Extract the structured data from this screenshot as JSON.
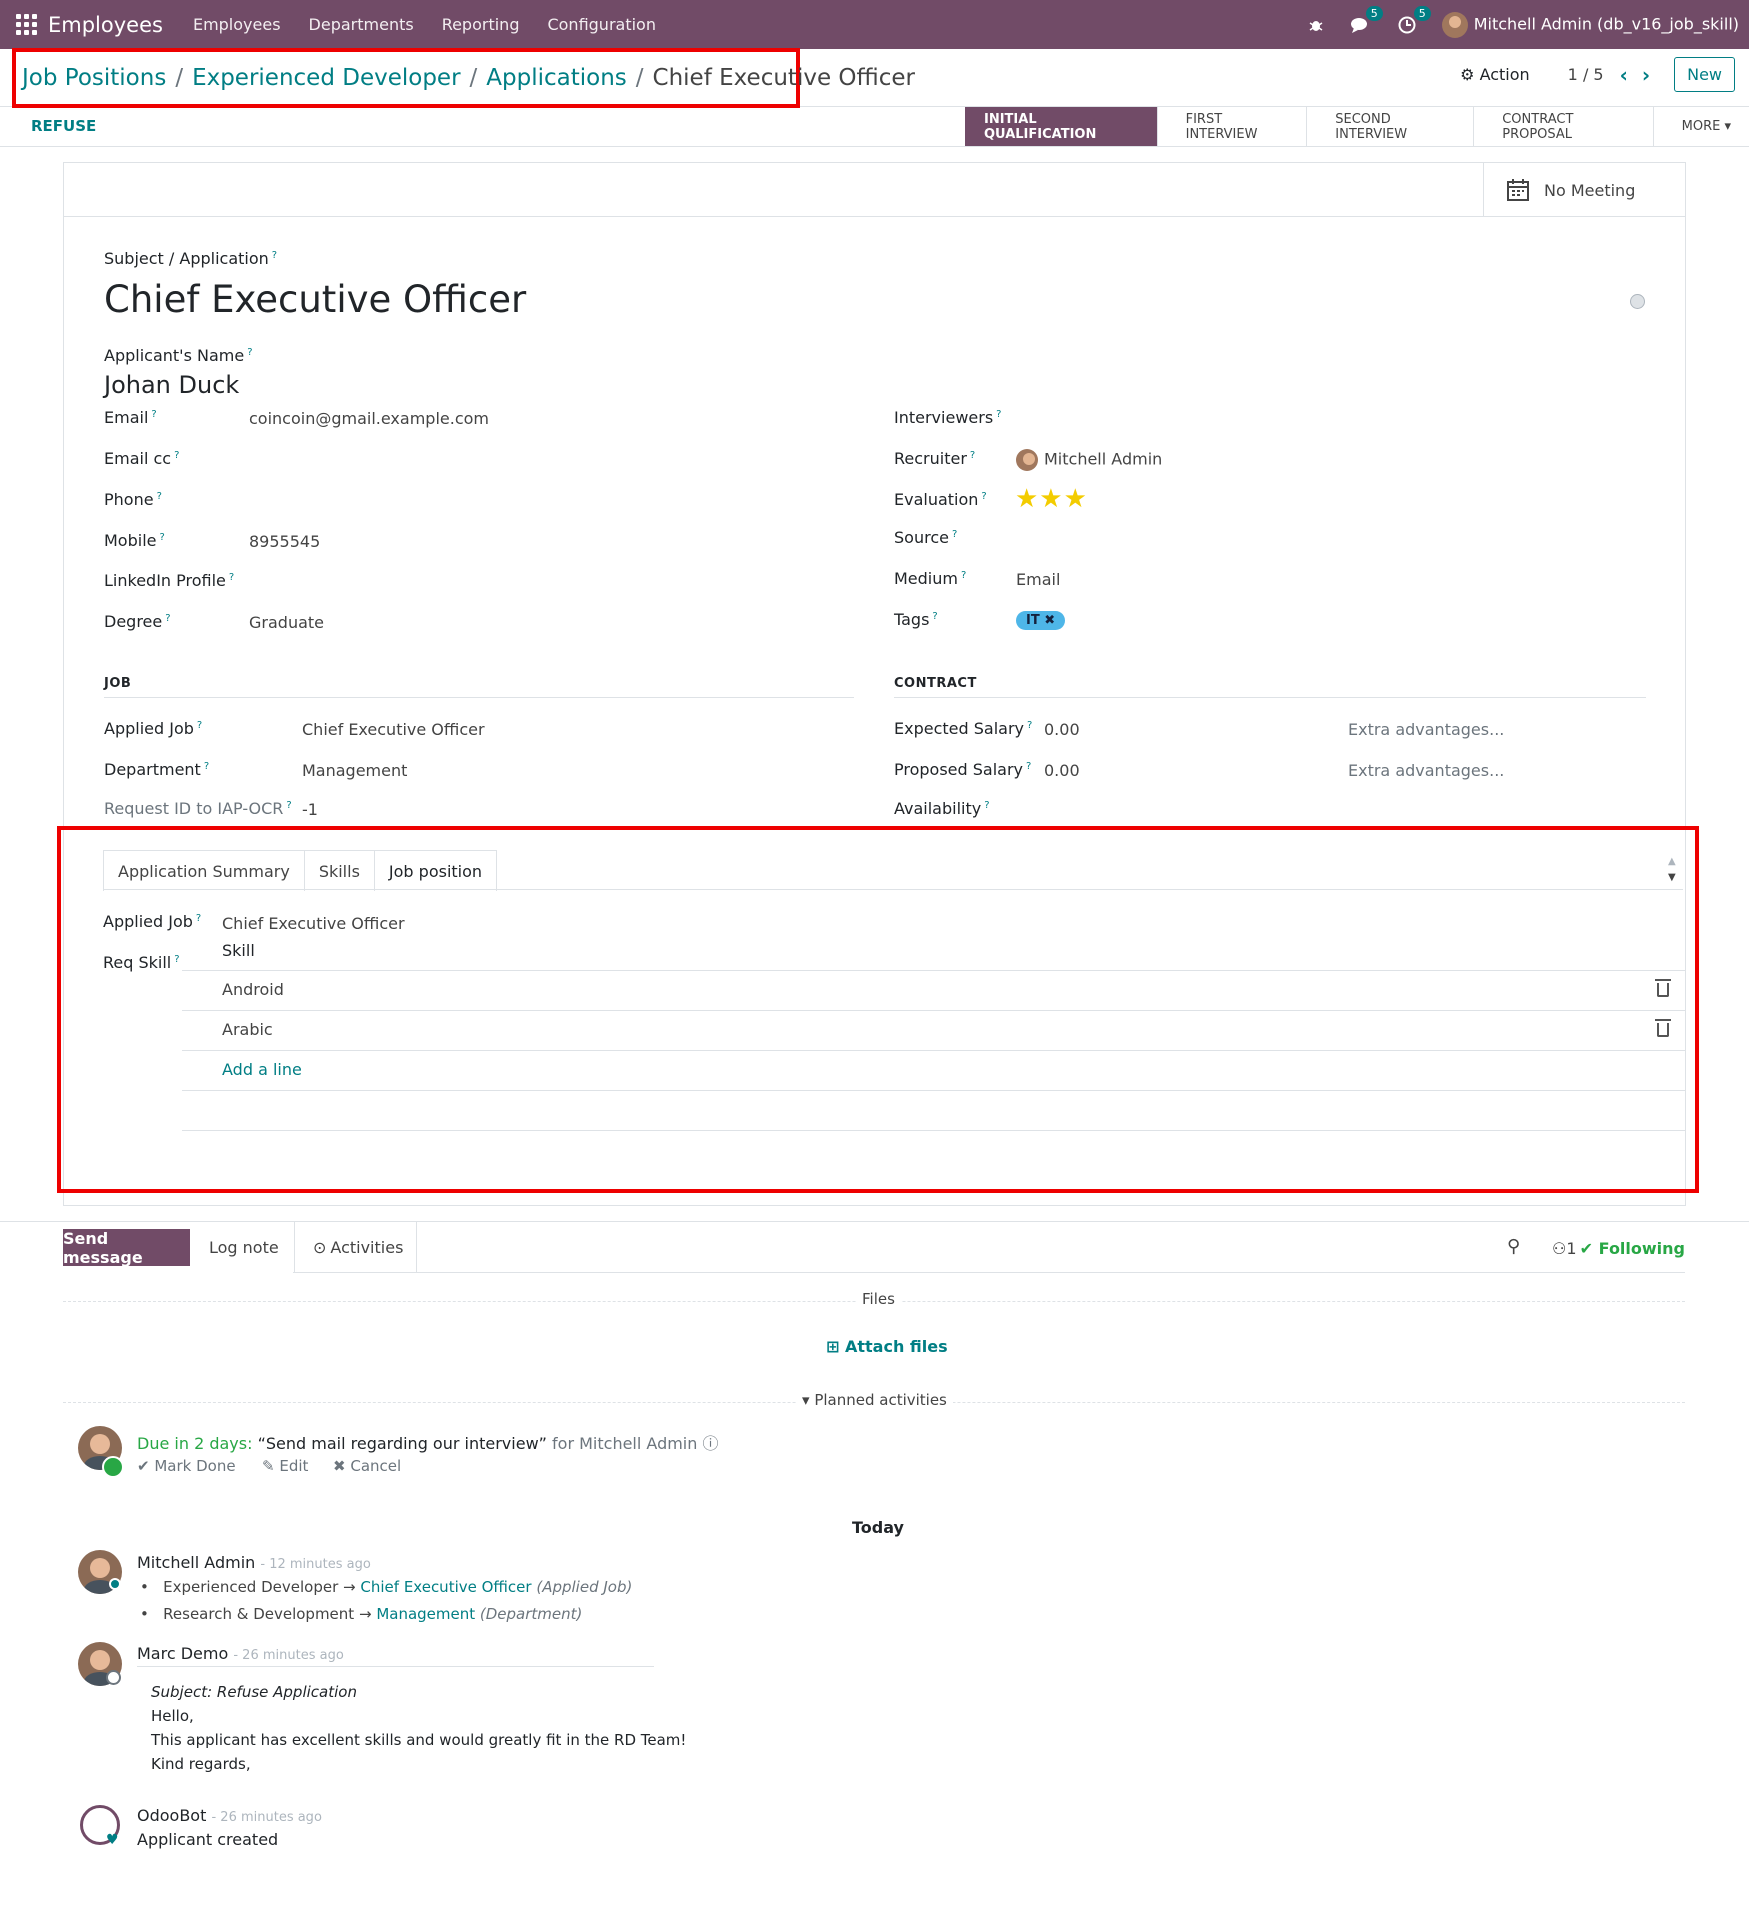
{
  "topbar": {
    "app_name": "Employees",
    "menu": [
      "Employees",
      "Departments",
      "Reporting",
      "Configuration"
    ],
    "chat_count": "5",
    "activity_count": "5",
    "user": "Mitchell Admin (db_v16_job_skill)"
  },
  "breadcrumb": {
    "items": [
      "Job Positions",
      "Experienced Developer",
      "Applications"
    ],
    "current": "Chief Executive Officer"
  },
  "control": {
    "action": "Action",
    "pager": "1 / 5",
    "new": "New"
  },
  "statusbar": {
    "refuse": "REFUSE",
    "stages": [
      "INITIAL QUALIFICATION",
      "FIRST INTERVIEW",
      "SECOND INTERVIEW",
      "CONTRACT PROPOSAL",
      "MORE"
    ]
  },
  "smart_button": "No Meeting",
  "form": {
    "subject_label": "Subject / Application",
    "subject": "Chief Executive Officer",
    "name_label": "Applicant's Name",
    "name": "Johan Duck",
    "left_fields": [
      {
        "label": "Email",
        "value": "coincoin@gmail.example.com"
      },
      {
        "label": "Email cc",
        "value": ""
      },
      {
        "label": "Phone",
        "value": ""
      },
      {
        "label": "Mobile",
        "value": "8955545"
      },
      {
        "label": "LinkedIn Profile",
        "value": ""
      },
      {
        "label": "Degree",
        "value": "Graduate"
      }
    ],
    "right_fields": [
      {
        "label": "Interviewers",
        "value": ""
      },
      {
        "label": "Recruiter",
        "value": "Mitchell Admin"
      },
      {
        "label": "Evaluation",
        "value": "★★★"
      },
      {
        "label": "Source",
        "value": ""
      },
      {
        "label": "Medium",
        "value": "Email"
      },
      {
        "label": "Tags",
        "value": "IT"
      }
    ],
    "job_section": "JOB",
    "job_fields": [
      {
        "label": "Applied Job",
        "value": "Chief Executive Officer"
      },
      {
        "label": "Department",
        "value": "Management"
      },
      {
        "label": "Request ID to IAP-OCR",
        "value": "-1"
      }
    ],
    "contract_section": "CONTRACT",
    "contract_fields": [
      {
        "label": "Expected Salary",
        "value": "0.00",
        "extra": "Extra advantages..."
      },
      {
        "label": "Proposed Salary",
        "value": "0.00",
        "extra": "Extra advantages..."
      },
      {
        "label": "Availability",
        "value": ""
      }
    ]
  },
  "notebook": {
    "tabs": [
      "Application Summary",
      "Skills",
      "Job position"
    ],
    "applied_job_label": "Applied Job",
    "applied_job": "Chief Executive Officer",
    "req_skill_label": "Req Skill",
    "skill_header": "Skill",
    "skills": [
      "Android",
      "Arabic"
    ],
    "add_line": "Add a line"
  },
  "chatter": {
    "send_message": "Send message",
    "log_note": "Log note",
    "activities": "Activities",
    "followers": "1",
    "following": "Following",
    "files": "Files",
    "attach": "Attach files",
    "planned": "Planned activities",
    "activity": {
      "due": "Due in 2 days:",
      "summary": "“Send mail regarding our interview”",
      "for": "for Mitchell Admin",
      "mark_done": "Mark Done",
      "edit": "Edit",
      "cancel": "Cancel"
    },
    "today": "Today",
    "messages": [
      {
        "author": "Mitchell Admin",
        "time": "- 12 minutes ago",
        "changes": [
          {
            "old": "Experienced Developer",
            "new": "Chief Executive Officer",
            "field": "(Applied Job)"
          },
          {
            "old": "Research & Development",
            "new": "Management",
            "field": "(Department)"
          }
        ]
      },
      {
        "author": "Marc Demo",
        "time": "- 26 minutes ago",
        "subject": "Subject: Refuse Application",
        "body": [
          "Hello,",
          "This applicant has excellent skills and would greatly fit in the RD Team!",
          "Kind regards,"
        ]
      },
      {
        "author": "OdooBot",
        "time": "- 26 minutes ago",
        "body": "Applicant created"
      }
    ]
  }
}
